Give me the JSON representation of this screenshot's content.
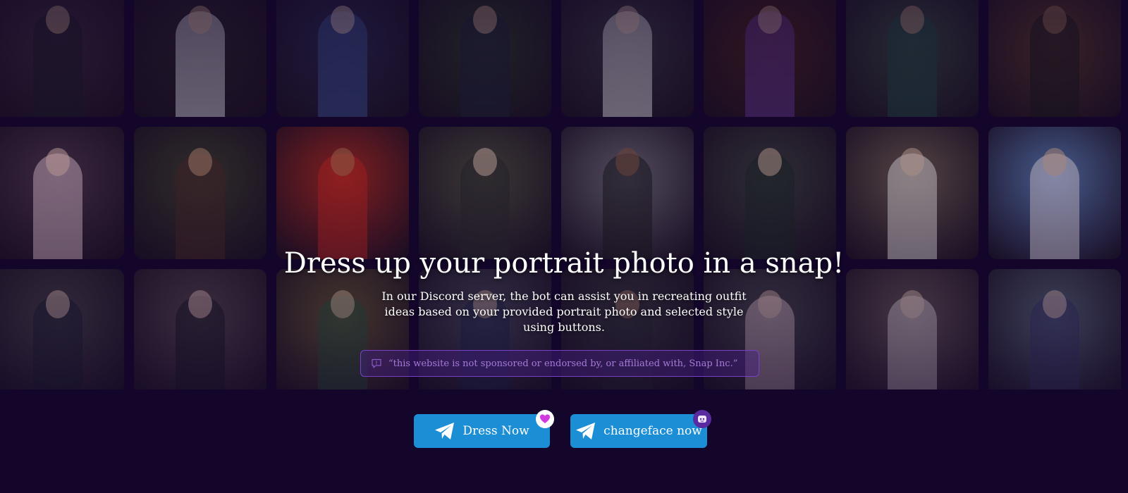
{
  "hero": {
    "title": "Dress up your portrait photo in a snap!",
    "description": "In our Discord server, the bot can assist you in recreating outfit ideas based on your provided portrait photo and selected style using buttons."
  },
  "notice": {
    "text": "“this website is not sponsored or endorsed by, or affiliated with, Snap Inc.”",
    "icon": "chat-bubble-icon"
  },
  "buttons": [
    {
      "label": "Dress Now",
      "icon": "telegram-plane-icon",
      "badge_icon": "heart-icon",
      "color": "#1b8ed6"
    },
    {
      "label": "changeface now",
      "icon": "telegram-plane-icon",
      "badge_icon": "face-icon",
      "color": "#1b8ed6"
    }
  ],
  "gallery": {
    "tiles": [
      {
        "bg": "#3a2a3a",
        "fig": "#1b1b22",
        "head": "#c9a58a"
      },
      {
        "bg": "#2a2326",
        "fig": "#e8e8ee",
        "head": "#c9a58a"
      },
      {
        "bg": "#2a2a4a",
        "fig": "#3d5a9a",
        "head": "#d8c0b0"
      },
      {
        "bg": "#2c3a24",
        "fig": "#1e2238",
        "head": "#d8b098"
      },
      {
        "bg": "#3c3a40",
        "fig": "#f2f2f2",
        "head": "#d8b8a8"
      },
      {
        "bg": "#4a2418",
        "fig": "#6a3aa0",
        "head": "#d0a898"
      },
      {
        "bg": "#3a4a3c",
        "fig": "#1f4a44",
        "head": "#c89a80"
      },
      {
        "bg": "#5a3a24",
        "fig": "#1a1a1a",
        "head": "#a87858"
      },
      {
        "bg": "#4a3448",
        "fig": "#f0d0d8",
        "head": "#f0c8b8"
      },
      {
        "bg": "#3a3a2a",
        "fig": "#4a2a24",
        "head": "#c89878"
      },
      {
        "bg": "#a8281c",
        "fig": "#c8281e",
        "head": "#b87850"
      },
      {
        "bg": "#4a4a3a",
        "fig": "#2a2a2a",
        "head": "#e8c8b0"
      },
      {
        "bg": "#6a6670",
        "fig": "#1a1a1a",
        "head": "#8a5a40"
      },
      {
        "bg": "#3a3c3a",
        "fig": "#1c2a24",
        "head": "#d8b8a0"
      },
      {
        "bg": "#6a5a4c",
        "fig": "#f4f0ec",
        "head": "#e0c0a8"
      },
      {
        "bg": "#5a7ab0",
        "fig": "#f0e8ec",
        "head": "#d8b098"
      },
      {
        "bg": "#4a4448",
        "fig": "#1e2030",
        "head": "#e8c8b8"
      },
      {
        "bg": "#5a4a50",
        "fig": "#1a1a22",
        "head": "#f0c8c0"
      },
      {
        "bg": "#6a5a30",
        "fig": "#2a5a3a",
        "head": "#e8c8a8"
      },
      {
        "bg": "#4a4a5a",
        "fig": "#1e2a4a",
        "head": "#d8b8a0"
      },
      {
        "bg": "#3a3a3e",
        "fig": "#2a2a30",
        "head": "#b88870"
      },
      {
        "bg": "#4a4a4e",
        "fig": "#e8c8d0",
        "head": "#e0c0b0"
      },
      {
        "bg": "#6a5a58",
        "fig": "#e8e0e0",
        "head": "#e8c8b8"
      },
      {
        "bg": "#5a6a7a",
        "fig": "#3a3a6a",
        "head": "#e8c8b8"
      }
    ]
  }
}
